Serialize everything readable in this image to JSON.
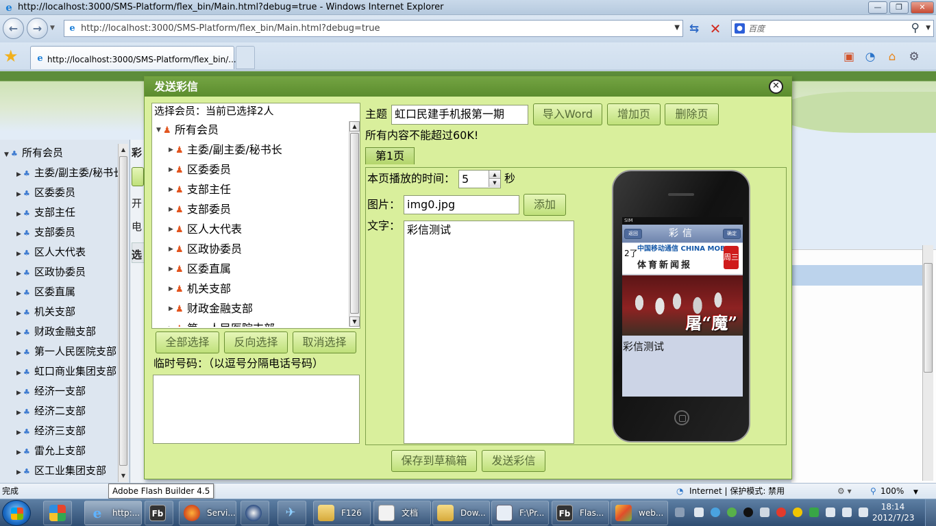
{
  "browser": {
    "window_title": "http://localhost:3000/SMS-Platform/flex_bin/Main.html?debug=true - Windows Internet Explorer",
    "url": "http://localhost:3000/SMS-Platform/flex_bin/Main.html?debug=true",
    "search_placeholder": "百度",
    "search_engine_icon": "baidu-icon",
    "tab_label": "http://localhost:3000/SMS-Platform/flex_bin/..."
  },
  "app": {
    "member_tree": [
      {
        "label": "所有会员",
        "level": 0,
        "expanded": true
      },
      {
        "label": "主委/副主委/秘书长",
        "level": 1
      },
      {
        "label": "区委委员",
        "level": 1
      },
      {
        "label": "支部主任",
        "level": 1
      },
      {
        "label": "支部委员",
        "level": 1
      },
      {
        "label": "区人大代表",
        "level": 1
      },
      {
        "label": "区政协委员",
        "level": 1
      },
      {
        "label": "区委直属",
        "level": 1
      },
      {
        "label": "机关支部",
        "level": 1
      },
      {
        "label": "财政金融支部",
        "level": 1
      },
      {
        "label": "第一人民医院支部",
        "level": 1
      },
      {
        "label": "虹口商业集团支部",
        "level": 1
      },
      {
        "label": "经济一支部",
        "level": 1
      },
      {
        "label": "经济二支部",
        "level": 1
      },
      {
        "label": "经济三支部",
        "level": 1
      },
      {
        "label": "雷允上支部",
        "level": 1
      },
      {
        "label": "区工业集团支部",
        "level": 1
      }
    ],
    "mid_text": [
      "彩",
      "开",
      "电",
      "选"
    ]
  },
  "dialog": {
    "title": "发送彩信",
    "member_header": "选择会员：当前已选择2人",
    "member_tree": [
      {
        "label": "所有会员",
        "level": 0,
        "expanded": true
      },
      {
        "label": "主委/副主委/秘书长",
        "level": 1
      },
      {
        "label": "区委委员",
        "level": 1
      },
      {
        "label": "支部主任",
        "level": 1
      },
      {
        "label": "支部委员",
        "level": 1
      },
      {
        "label": "区人大代表",
        "level": 1
      },
      {
        "label": "区政协委员",
        "level": 1
      },
      {
        "label": "区委直属",
        "level": 1
      },
      {
        "label": "机关支部",
        "level": 1
      },
      {
        "label": "财政金融支部",
        "level": 1
      },
      {
        "label": "第一人民医院支部",
        "level": 1
      }
    ],
    "select_all": "全部选择",
    "invert_select": "反向选择",
    "cancel_select": "取消选择",
    "temp_numbers_label": "临时号码：（以逗号分隔电话号码）",
    "temp_numbers_value": "",
    "subject_label": "主题",
    "subject_value": "虹口民建手机报第一期",
    "import_word": "导入Word",
    "add_page": "增加页",
    "delete_page": "删除页",
    "size_notice": "所有内容不能超过60K!",
    "page_tab": "第1页",
    "play_time_label": "本页播放的时间：",
    "play_time_value": "5",
    "seconds_unit": "秒",
    "image_label": "图片：",
    "image_value": "img0.jpg",
    "add_button": "添加",
    "text_label": "文字：",
    "text_value": "彩信测试",
    "save_draft": "保存到草稿箱",
    "send_mms": "发送彩信",
    "preview": {
      "status": "SIM",
      "nav_back": "返回",
      "nav_title": "彩信",
      "nav_ok": "确定",
      "banner_logo": "中国移动通信 CHINA MOBILE",
      "banner_title": "体育新闻报",
      "banner_mark": "2了",
      "banner_badge": "周三",
      "photo_caption": "屠“魔”",
      "text": "彩信测试"
    }
  },
  "statusbar": {
    "left": "完成",
    "zone": "Internet | 保护模式: 禁用",
    "zoom": "100%",
    "tooltip": "Adobe Flash Builder 4.5"
  },
  "taskbar": {
    "items": [
      {
        "label": "http:...",
        "icon": "ie-icon"
      },
      {
        "label": "",
        "icon": "flash-builder-icon"
      },
      {
        "label": "Servi...",
        "icon": "firefox-icon"
      },
      {
        "label": "",
        "icon": "media-icon"
      },
      {
        "label": "",
        "icon": "plane-icon"
      },
      {
        "label": "F126",
        "icon": "folder-icon"
      },
      {
        "label": "文档",
        "icon": "document-icon"
      },
      {
        "label": "Dow...",
        "icon": "folder-icon"
      },
      {
        "label": "F:\\Pr...",
        "icon": "window-icon"
      },
      {
        "label": "Flas...",
        "icon": "flash-builder-icon"
      },
      {
        "label": "web...",
        "icon": "tools-icon"
      }
    ],
    "fb_label": "Fb",
    "time": "18:14",
    "date": "2012/7/23"
  }
}
